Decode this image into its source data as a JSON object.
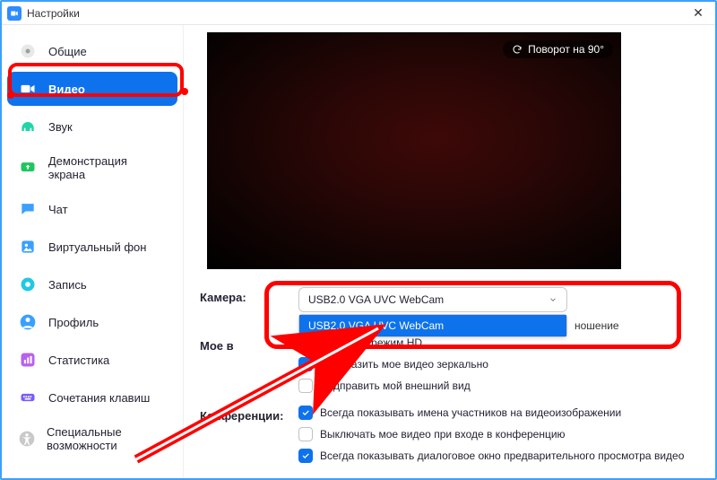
{
  "window": {
    "title": "Настройки"
  },
  "sidebar": {
    "items": [
      {
        "label": "Общие"
      },
      {
        "label": "Видео"
      },
      {
        "label": "Звук"
      },
      {
        "label": "Демонстрация экрана"
      },
      {
        "label": "Чат"
      },
      {
        "label": "Виртуальный фон"
      },
      {
        "label": "Запись"
      },
      {
        "label": "Профиль"
      },
      {
        "label": "Статистика"
      },
      {
        "label": "Сочетания клавиш"
      },
      {
        "label": "Специальные возможности"
      }
    ]
  },
  "preview": {
    "rotate_label": "Поворот на 90°"
  },
  "camera": {
    "label": "Камера:",
    "selected": "USB2.0 VGA UVC WebCam",
    "option": "USB2.0 VGA UVC WebCam",
    "ratio_suffix": "ношение"
  },
  "myvideo": {
    "label": "Мое в",
    "hd": "Включить режим HD",
    "mirror": "Отобразить мое видео зеркально",
    "touchup": "Подправить мой внешний вид"
  },
  "conf": {
    "label": "Конференции:",
    "names": "Всегда показывать имена участников на видеоизображении",
    "mute_video": "Выключать мое видео при входе в конференцию",
    "preview_dialog": "Всегда показывать диалоговое окно предварительного просмотра видео"
  }
}
